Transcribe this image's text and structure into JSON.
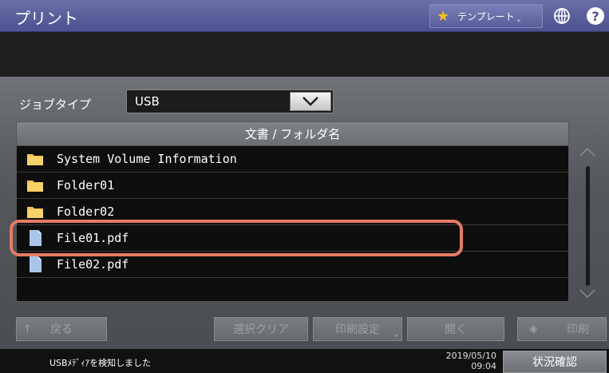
{
  "header": {
    "title": "プリント",
    "template_label": "テンプレート",
    "help_label": "?"
  },
  "job_type": {
    "label": "ジョブタイプ",
    "value": "USB"
  },
  "file_list": {
    "column_header": "文書 / フォルダ名",
    "items": [
      {
        "name": "System Volume Information",
        "type": "folder"
      },
      {
        "name": "Folder01",
        "type": "folder"
      },
      {
        "name": "Folder02",
        "type": "folder"
      },
      {
        "name": "File01.pdf",
        "type": "file"
      },
      {
        "name": "File02.pdf",
        "type": "file"
      }
    ],
    "highlighted_item": "File01.pdf"
  },
  "buttons": {
    "back": "戻る",
    "clear_selection": "選択クリア",
    "print_settings": "印刷設定",
    "open": "開く",
    "print": "印刷"
  },
  "status": {
    "message": "USBﾒﾃﾞｨｱを検知しました",
    "date": "2019/05/10",
    "time": "09:04",
    "status_button": "状況確認"
  },
  "colors": {
    "title_bar": "#5a5f9c",
    "highlight_ring": "#e57b66",
    "folder_icon": "#f2c14e",
    "file_icon": "#a9c6ea",
    "star": "#f4c21b"
  },
  "icons": {
    "template": "star-icon",
    "language": "globe-icon",
    "help": "help-icon",
    "dropdown": "chevron-down-icon",
    "folder": "folder-icon",
    "file": "file-icon"
  }
}
